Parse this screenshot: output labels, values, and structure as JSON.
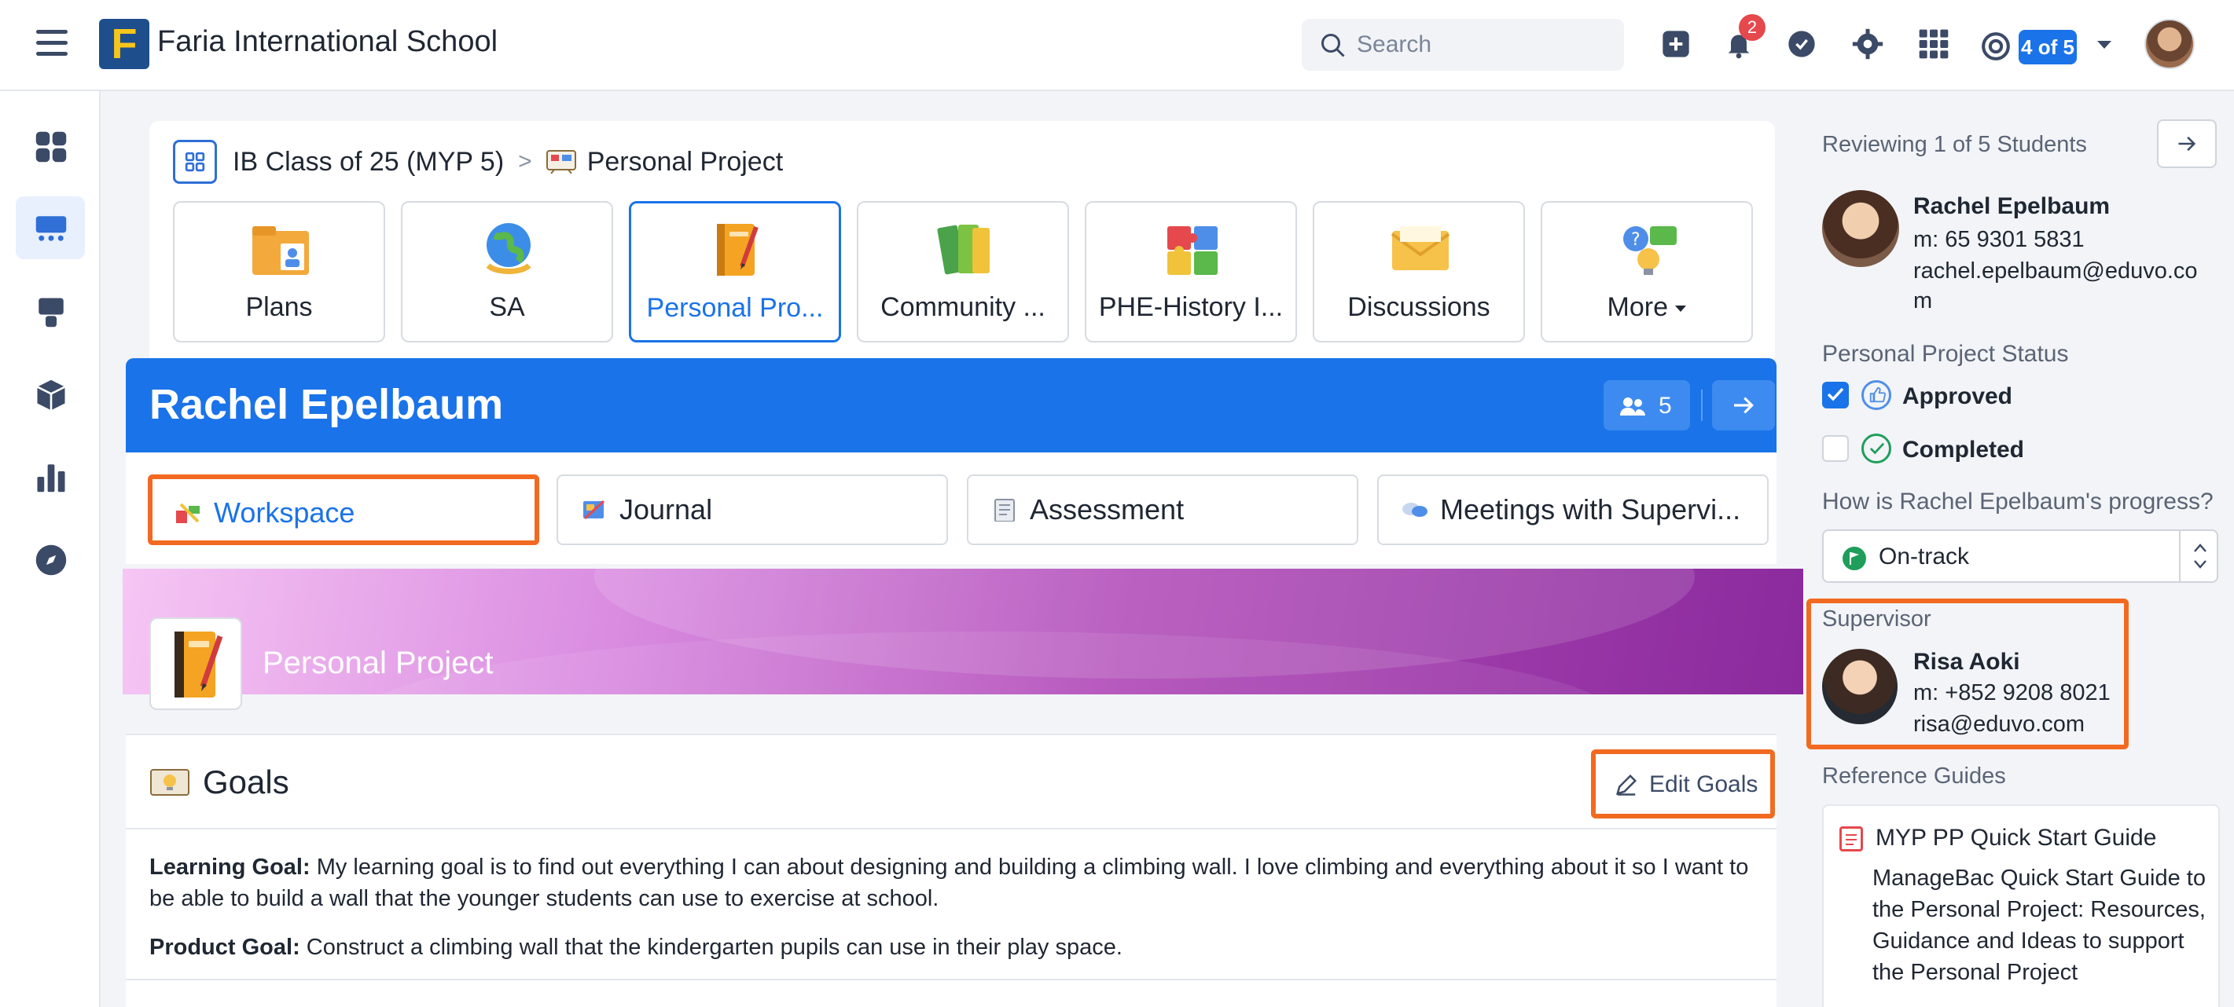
{
  "topbar": {
    "school_name": "Faria International School",
    "logo_letter": "F",
    "search_placeholder": "Search",
    "notification_count": "2",
    "review_pill": "4 of 5"
  },
  "breadcrumb": {
    "class_name": "IB Class of 25 (MYP 5)",
    "separator": ">",
    "current": "Personal Project"
  },
  "tiles": [
    {
      "label": "Plans"
    },
    {
      "label": "SA"
    },
    {
      "label": "Personal Pro..."
    },
    {
      "label": "Community ..."
    },
    {
      "label": "PHE-History I..."
    },
    {
      "label": "Discussions"
    },
    {
      "label": "More"
    }
  ],
  "student": {
    "name": "Rachel Epelbaum",
    "count": "5"
  },
  "subtabs": [
    {
      "label": "Workspace"
    },
    {
      "label": "Journal"
    },
    {
      "label": "Assessment"
    },
    {
      "label": "Meetings with Supervi..."
    }
  ],
  "banner": {
    "title": "Personal Project"
  },
  "goals": {
    "title": "Goals",
    "edit_label": "Edit Goals",
    "learning_goal_label": "Learning Goal:",
    "learning_goal_text": "My learning goal is to find out everything I can about designing and building a climbing wall. I love climbing and everything about it so I want to be able to build a wall that the younger students can use to exercise at school.",
    "product_goal_label": "Product Goal:",
    "product_goal_text": "Construct a climbing wall that the kindergarten pupils can use in their play space."
  },
  "right_panel": {
    "reviewing": "Reviewing 1 of 5 Students",
    "student_name": "Rachel Epelbaum",
    "student_phone": "m: 65 9301 5831",
    "student_email_1": "rachel.epelbaum@eduvo.co",
    "student_email_2": "m",
    "status_label": "Personal Project Status",
    "approved_label": "Approved",
    "completed_label": "Completed",
    "progress_question": "How is Rachel Epelbaum's progress?",
    "progress_value": "On-track",
    "supervisor_label": "Supervisor",
    "supervisor_name": "Risa Aoki",
    "supervisor_phone": "m: +852 9208 8021",
    "supervisor_email": "risa@eduvo.com",
    "reference_label": "Reference Guides",
    "guide_title": "MYP PP Quick Start Guide",
    "guide_desc": "ManageBac Quick Start Guide to the Personal Project: Resources, Guidance and Ideas to support the Personal Project"
  },
  "colors": {
    "accent": "#1a73e8",
    "highlight": "#f26a21",
    "banner_start": "#f6c6f4",
    "banner_end": "#8a2a9c"
  }
}
